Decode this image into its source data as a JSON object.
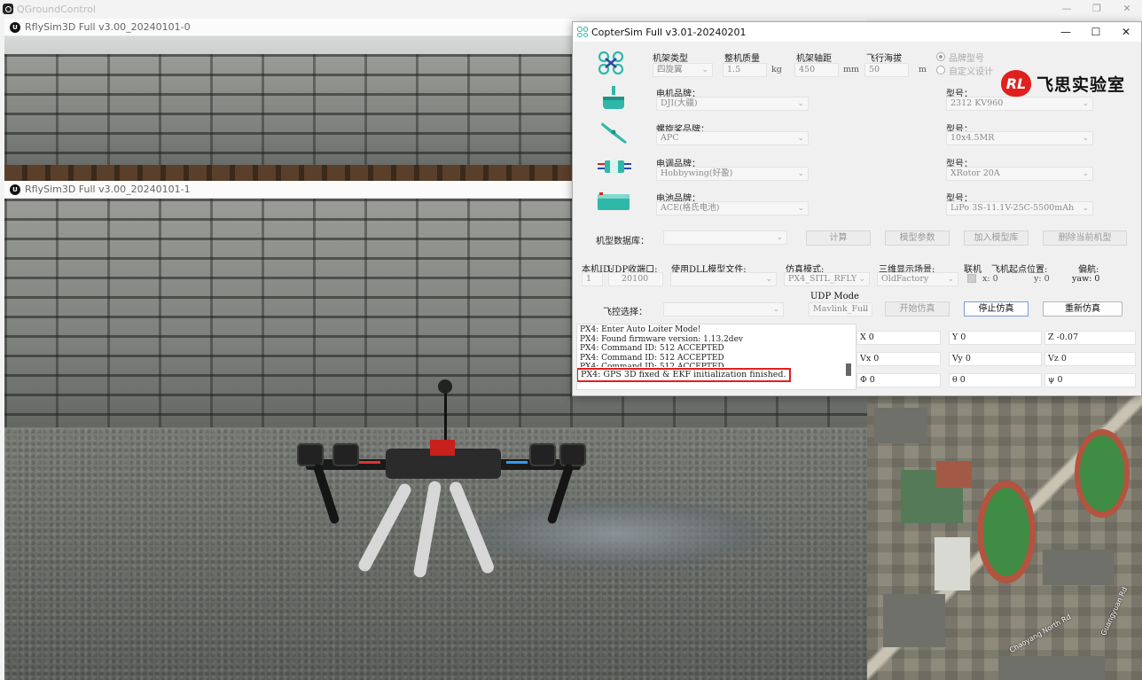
{
  "qgc": {
    "title": "QGroundControl"
  },
  "rfly0": {
    "title": "RflySim3D Full v3.00_20240101-0"
  },
  "rfly1": {
    "title": "RflySim3D Full v3.00_20240101-1"
  },
  "coptersim": {
    "title": "CopterSim Full v3.01-20240201",
    "frame": {
      "type_label": "机架类型",
      "type_value": "四旋翼",
      "mass_label": "整机质量",
      "mass_value": "1.5",
      "mass_unit": "kg",
      "wheelbase_label": "机架轴距",
      "wheelbase_value": "450",
      "wheelbase_unit": "mm",
      "altitude_label": "飞行海拔",
      "altitude_value": "50",
      "altitude_unit": "m",
      "opt_brand": "品牌型号",
      "opt_custom": "自定义设计"
    },
    "logo": {
      "badge": "RL",
      "text": "飞思实验室"
    },
    "parts": [
      {
        "brand_label": "电机品牌：",
        "brand_value": "DJI(大疆)",
        "model_label": "型号：",
        "model_value": "2312 KV960",
        "icon": "motor-icon"
      },
      {
        "brand_label": "螺旋桨品牌：",
        "brand_value": "APC",
        "model_label": "型号：",
        "model_value": "10x4.5MR",
        "icon": "propeller-icon"
      },
      {
        "brand_label": "电调品牌：",
        "brand_value": "Hobbywing(好盈)",
        "model_label": "型号：",
        "model_value": "XRotor 20A",
        "icon": "esc-icon"
      },
      {
        "brand_label": "电池品牌：",
        "brand_value": "ACE(格氏电池)",
        "model_label": "型号：",
        "model_value": "LiPo 3S-11.1V-25C-5500mAh",
        "icon": "battery-icon"
      }
    ],
    "model_db": {
      "label": "机型数据库：",
      "value": "",
      "btn_compute": "计算",
      "btn_params": "模型参数",
      "btn_add": "加入模型库",
      "btn_delete": "删除当前机型"
    },
    "sim": {
      "id_label": "本机ID:",
      "id_value": "1",
      "udp_port_label": "UDP收端口:",
      "udp_port_value": "20100",
      "dll_label": "使用DLL模型文件:",
      "dll_value": "",
      "mode_label": "仿真模式:",
      "mode_value": "PX4_SITL_RFLY",
      "scene_label": "三维显示场景:",
      "scene_value": "OldFactory",
      "link_label": "联机",
      "start_pos_label": "飞机起点位置:",
      "x_label": "x: 0",
      "y_label": "y: 0",
      "yaw_label": "偏航:",
      "yaw_value": "yaw:  0",
      "fc_label": "飞控选择：",
      "fc_value": "",
      "udp_mode_label": "UDP Mode",
      "udp_mode_value": "Mavlink_Full",
      "btn_start": "开始仿真",
      "btn_stop": "停止仿真",
      "btn_reset": "重新仿真"
    },
    "console": {
      "lines": [
        "PX4: Enter Auto Loiter Mode!",
        "PX4: Found firmware version: 1.13.2dev",
        "PX4: Command ID: 512 ACCEPTED",
        "PX4: Command ID: 512 ACCEPTED",
        "PX4: Command ID: 512 ACCEPTED"
      ],
      "highlight": "PX4: GPS 3D fixed & EKF initialization finished."
    },
    "state": {
      "x": "X 0",
      "y": "Y 0",
      "z": "Z -0.07",
      "vx": "Vx 0",
      "vy": "Vy 0",
      "vz": "Vz 0",
      "phi": "Φ 0",
      "theta": "θ 0",
      "psi": "ψ 0"
    }
  },
  "map": {
    "road1": "Chaoyang North Rd",
    "road2": "Guangyuan Rd"
  },
  "colors": {
    "accent_red": "#e0201d",
    "teal": "#2fb8a8"
  }
}
